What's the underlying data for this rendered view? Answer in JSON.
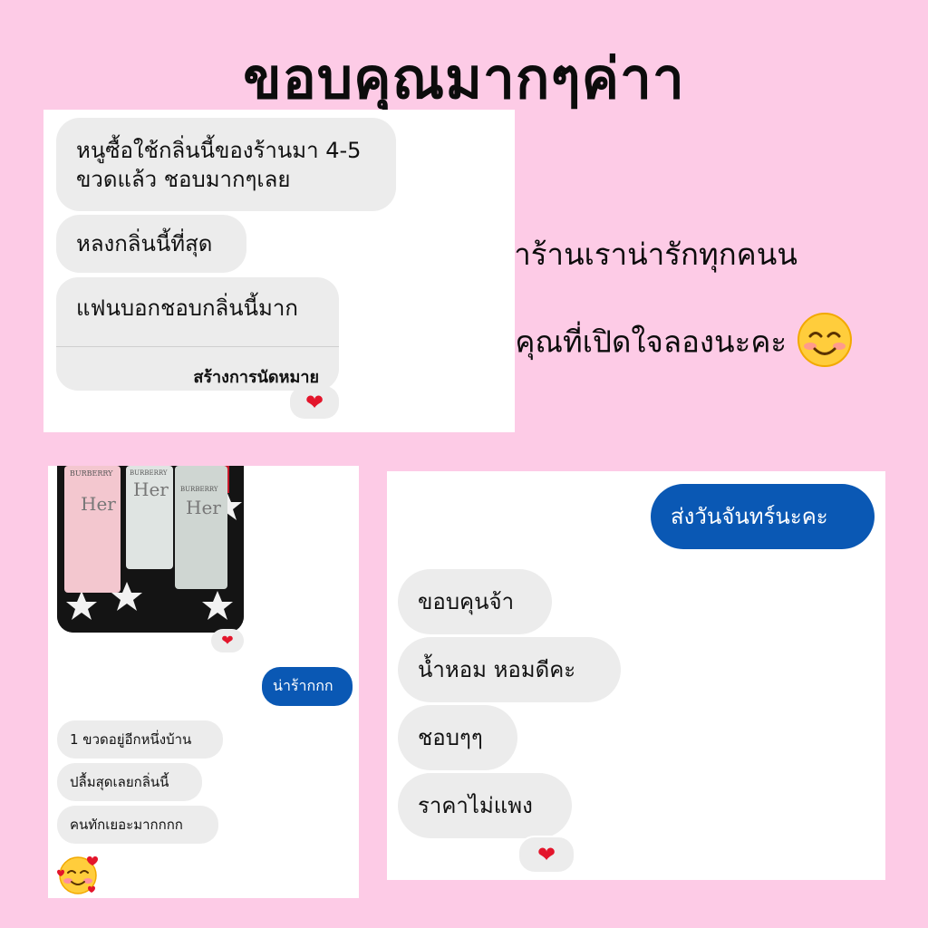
{
  "title": "ขอบคุณมากๆค่าา",
  "side_text": {
    "line1": "ลูกค้าร้านเราน่ารักทุกคนน",
    "line2": "ขอบคุณที่เปิดใจลองนะคะ",
    "emoji": "smiling-face-emoji"
  },
  "chat1": {
    "messages": [
      "หนูซื้อใช้กลิ่นนี้ของร้านมา 4-5",
      "ขวดแล้ว ชอบมากๆเลย",
      "หลงกลิ่นนี้ที่สุด",
      "แฟนบอกชอบกลิ่นนี้มาก"
    ],
    "action": "สร้างการนัดหมาย",
    "reaction": "❤"
  },
  "chat2": {
    "photo_labels": [
      "BURBERRY",
      "Her",
      "BURBERRY",
      "Her",
      "BURBERRY",
      "Her"
    ],
    "photo_reaction": "❤",
    "my_message": "น่าร้ากกก",
    "messages": [
      "1 ขวดอยู่อีกหนึ่งบ้าน",
      "ปลื้มสุดเลยกลิ่นนี้",
      "คนทักเยอะมากกกก"
    ],
    "emoji": "smiling-face-with-hearts-emoji"
  },
  "chat3": {
    "my_message": "ส่งวันจันทร์นะคะ",
    "messages": [
      "ขอบคุนจ้า",
      "น้ำหอม หอมดีคะ",
      "ชอบๆๆ",
      "ราคาไม่แพง"
    ],
    "reaction": "❤"
  },
  "colors": {
    "background": "#fdcbe6",
    "bubble_gray": "#ececec",
    "bubble_blue": "#0a58b4",
    "heart": "#e3152b"
  }
}
